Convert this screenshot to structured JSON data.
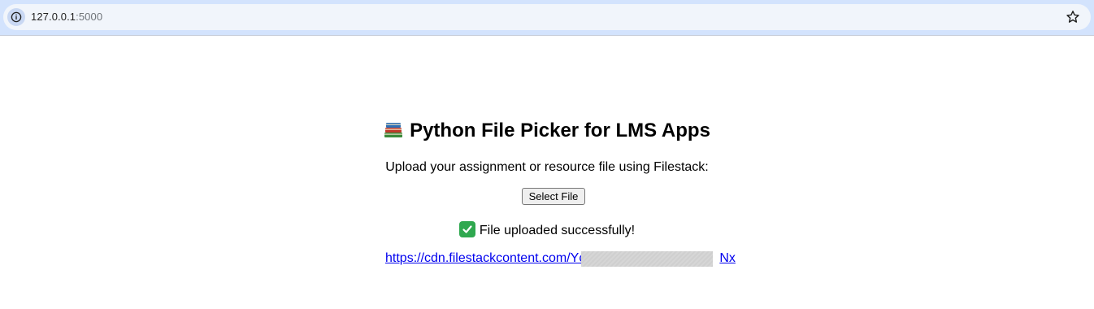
{
  "browser": {
    "url_host": "127.0.0.1",
    "url_port": ":5000",
    "info_icon": "info-icon",
    "bookmark_icon": "star-icon"
  },
  "page": {
    "title_icon": "books-emoji-icon",
    "title": "Python File Picker for LMS Apps",
    "subtitle": "Upload your assignment or resource file using Filestack:",
    "select_button_label": "Select File",
    "status_icon": "check-mark-icon",
    "status_text": "File uploaded successfully!",
    "file_link": "https://cdn.filestackcontent.com/Yc",
    "file_link_tail": "Nx"
  },
  "colors": {
    "browser_bar": "#d3e3fd",
    "link": "#0000ee",
    "success": "#2fa84f"
  }
}
